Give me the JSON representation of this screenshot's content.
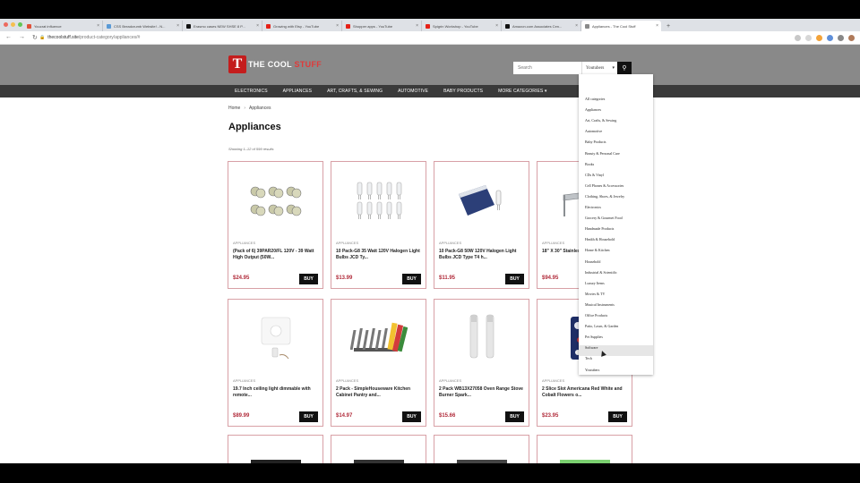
{
  "tabs": [
    {
      "title": "Youcrat influence",
      "fav": "#e0523a"
    },
    {
      "title": "CSS Breadcrumb Website! - N...",
      "fav": "#5a9ad6"
    },
    {
      "title": "Erasmo cases NEW SHSE 8 P...",
      "fav": "#111111"
    },
    {
      "title": "Growing with Etsy - YouTube",
      "fav": "#e62117"
    },
    {
      "title": "Shopper apps - YouTube",
      "fav": "#e62117"
    },
    {
      "title": "Spigrin Workshop - YouTube",
      "fav": "#e62117"
    },
    {
      "title": "Amazon.com Associates Cen...",
      "fav": "#111111"
    },
    {
      "title": "Appliances - The Cool Stuff",
      "fav": "#8a8a8a"
    }
  ],
  "addressbar": {
    "host": "thecoolstuff.site",
    "path": "/product-category/appliances/#"
  },
  "logo": {
    "letter": "T",
    "text_a": "THE COOL ",
    "text_b": "STUFF"
  },
  "search": {
    "placeholder": "Search",
    "selected": "Youtubers",
    "button_icon": "search-icon"
  },
  "nav": [
    "ELECTRONICS",
    "APPLIANCES",
    "ART, CRAFTS, & SEWING",
    "AUTOMOTIVE",
    "BABY PRODUCTS",
    "MORE CATEGORIES ▾"
  ],
  "breadcrumb": {
    "home": "Home",
    "current": "Appliances"
  },
  "page_title": "Appliances",
  "result_count": "Showing 1–12 of 599 results",
  "products": [
    {
      "category": "APPLIANCES",
      "name": "(Pack of 6) 39PAR20/FL 120V - 39 Watt High Output (50W...",
      "price": "$24.95",
      "buy": "BUY",
      "img": "bulbs"
    },
    {
      "category": "APPLIANCES",
      "name": "10 Pack-G8 35 Watt 120V Halogen Light Bulbs JCD Ty...",
      "price": "$13.99",
      "buy": "BUY",
      "img": "halogen"
    },
    {
      "category": "APPLIANCES",
      "name": "10 Pack-G8 50W 120V Halogen Light Bulbs JCD Type T4 h...",
      "price": "$11.95",
      "buy": "BUY",
      "img": "box"
    },
    {
      "category": "APPLIANCES",
      "name": "18\" X 30\" Stainless Steel Shelf | NSF K...",
      "price": "$94.95",
      "buy": "BUY",
      "img": "shelf"
    },
    {
      "category": "APPLIANCES",
      "name": "19.7 Inch ceiling light dimmable with remote...",
      "price": "$89.99",
      "buy": "BUY",
      "img": "ceiling"
    },
    {
      "category": "APPLIANCES",
      "name": "2 Pack - SimpleHouseware Kitchen Cabinet Pantry and...",
      "price": "$14.97",
      "buy": "BUY",
      "img": "organizer"
    },
    {
      "category": "APPLIANCES",
      "name": "2 Pack WB13X27058 Oven Range Stove Burner Spark...",
      "price": "$15.66",
      "buy": "BUY",
      "img": "spark"
    },
    {
      "category": "APPLIANCES",
      "name": "2 Slice Slot Americana Red White and Cobalt Flowers o...",
      "price": "$23.95",
      "buy": "BUY",
      "img": "toaster"
    }
  ],
  "dropdown": [
    "All categories",
    "Appliances",
    "Art, Crafts, & Sewing",
    "Automotive",
    "Baby Products",
    "Beauty & Personal Care",
    "Books",
    "CDs & Vinyl",
    "Cell Phones & Accessories",
    "Clothing, Shoes, & Jewelry",
    "Electronics",
    "Grocery & Gourmet Food",
    "Handmade Products",
    "Health & Household",
    "Home & Kitchen",
    "Household",
    "Industrial & Scientific",
    "Luxury Items",
    "Movies & TV",
    "Musical Instruments",
    "Office Products",
    "Patio, Lawn, & Garden",
    "Pet Supplies",
    "Software",
    "Tech",
    "Youtubers"
  ],
  "colors": {
    "brand": "#c41d1d",
    "price": "#b12b3a",
    "header": "#898989",
    "nav": "#3a3a3a"
  }
}
